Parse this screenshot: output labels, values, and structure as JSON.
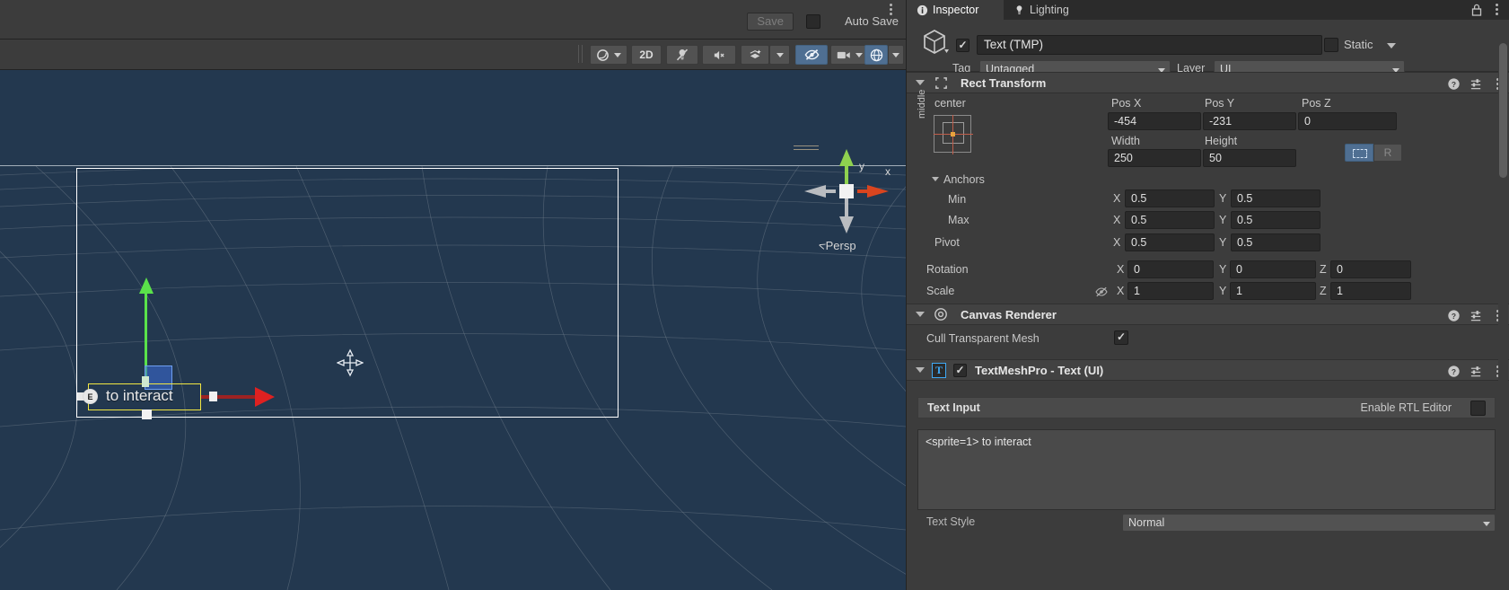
{
  "scene": {
    "save_button": "Save",
    "auto_save_label": "Auto Save",
    "toolbar": {
      "shading_icon": "sphere-shading-icon",
      "two_d_label": "2D",
      "lighting_icon": "lighting-off-icon",
      "audio_icon": "audio-mute-icon",
      "fx_icon": "effects-icon",
      "hidden_icon": "visibility-toggle-icon",
      "camera_icon": "scene-camera-icon",
      "gizmos_icon": "gizmos-globe-icon"
    },
    "gizmo": {
      "y_label": "y",
      "x_label": "x",
      "persp_label": "Persp"
    },
    "object_text": "to interact",
    "sprite_badge": "E"
  },
  "inspector": {
    "tabs": [
      {
        "label": "Inspector",
        "icon": "info-icon",
        "active": true
      },
      {
        "label": "Lighting",
        "icon": "bulb-icon",
        "active": false
      }
    ],
    "lock_icon": "lock-icon",
    "menu_icon": "kebab-menu-icon",
    "object": {
      "icon": "gameobject-cube-icon",
      "enabled": true,
      "name": "Text (TMP)",
      "static_label": "Static",
      "static_checked": false,
      "tag_label": "Tag",
      "tag_value": "Untagged",
      "layer_label": "Layer",
      "layer_value": "UI"
    },
    "rect_transform": {
      "title": "Rect Transform",
      "anchor_preset_label": "center",
      "anchor_preset_vertical_label": "middle",
      "pos_x_label": "Pos X",
      "pos_y_label": "Pos Y",
      "pos_z_label": "Pos Z",
      "pos_x": "-454",
      "pos_y": "-231",
      "pos_z": "0",
      "width_label": "Width",
      "height_label": "Height",
      "width": "250",
      "height": "50",
      "raw_button": "R",
      "anchors_label": "Anchors",
      "min_label": "Min",
      "max_label": "Max",
      "pivot_label": "Pivot",
      "min_x": "0.5",
      "min_y": "0.5",
      "max_x": "0.5",
      "max_y": "0.5",
      "pivot_x": "0.5",
      "pivot_y": "0.5",
      "rotation_label": "Rotation",
      "rot_x": "0",
      "rot_y": "0",
      "rot_z": "0",
      "scale_label": "Scale",
      "scale_x": "1",
      "scale_y": "1",
      "scale_z": "1",
      "axis_x": "X",
      "axis_y": "Y",
      "axis_z": "Z"
    },
    "canvas_renderer": {
      "title": "Canvas Renderer",
      "cull_label": "Cull Transparent Mesh",
      "cull_checked": true
    },
    "textmeshpro": {
      "title": "TextMeshPro - Text (UI)",
      "icon_letter": "T",
      "enabled": true,
      "text_input_label": "Text Input",
      "rtl_label": "Enable RTL Editor",
      "rtl_checked": false,
      "text_value": "<sprite=1> to interact",
      "text_style_label": "Text Style",
      "text_style_value": "Normal"
    }
  },
  "colors": {
    "accent_blue": "#4f6f92",
    "scene_bg": "#23384f",
    "panel_bg": "#3c3c3c",
    "axis_green": "#5ae24a",
    "axis_red": "#df2121",
    "selection_yellow": "#f1e642"
  }
}
